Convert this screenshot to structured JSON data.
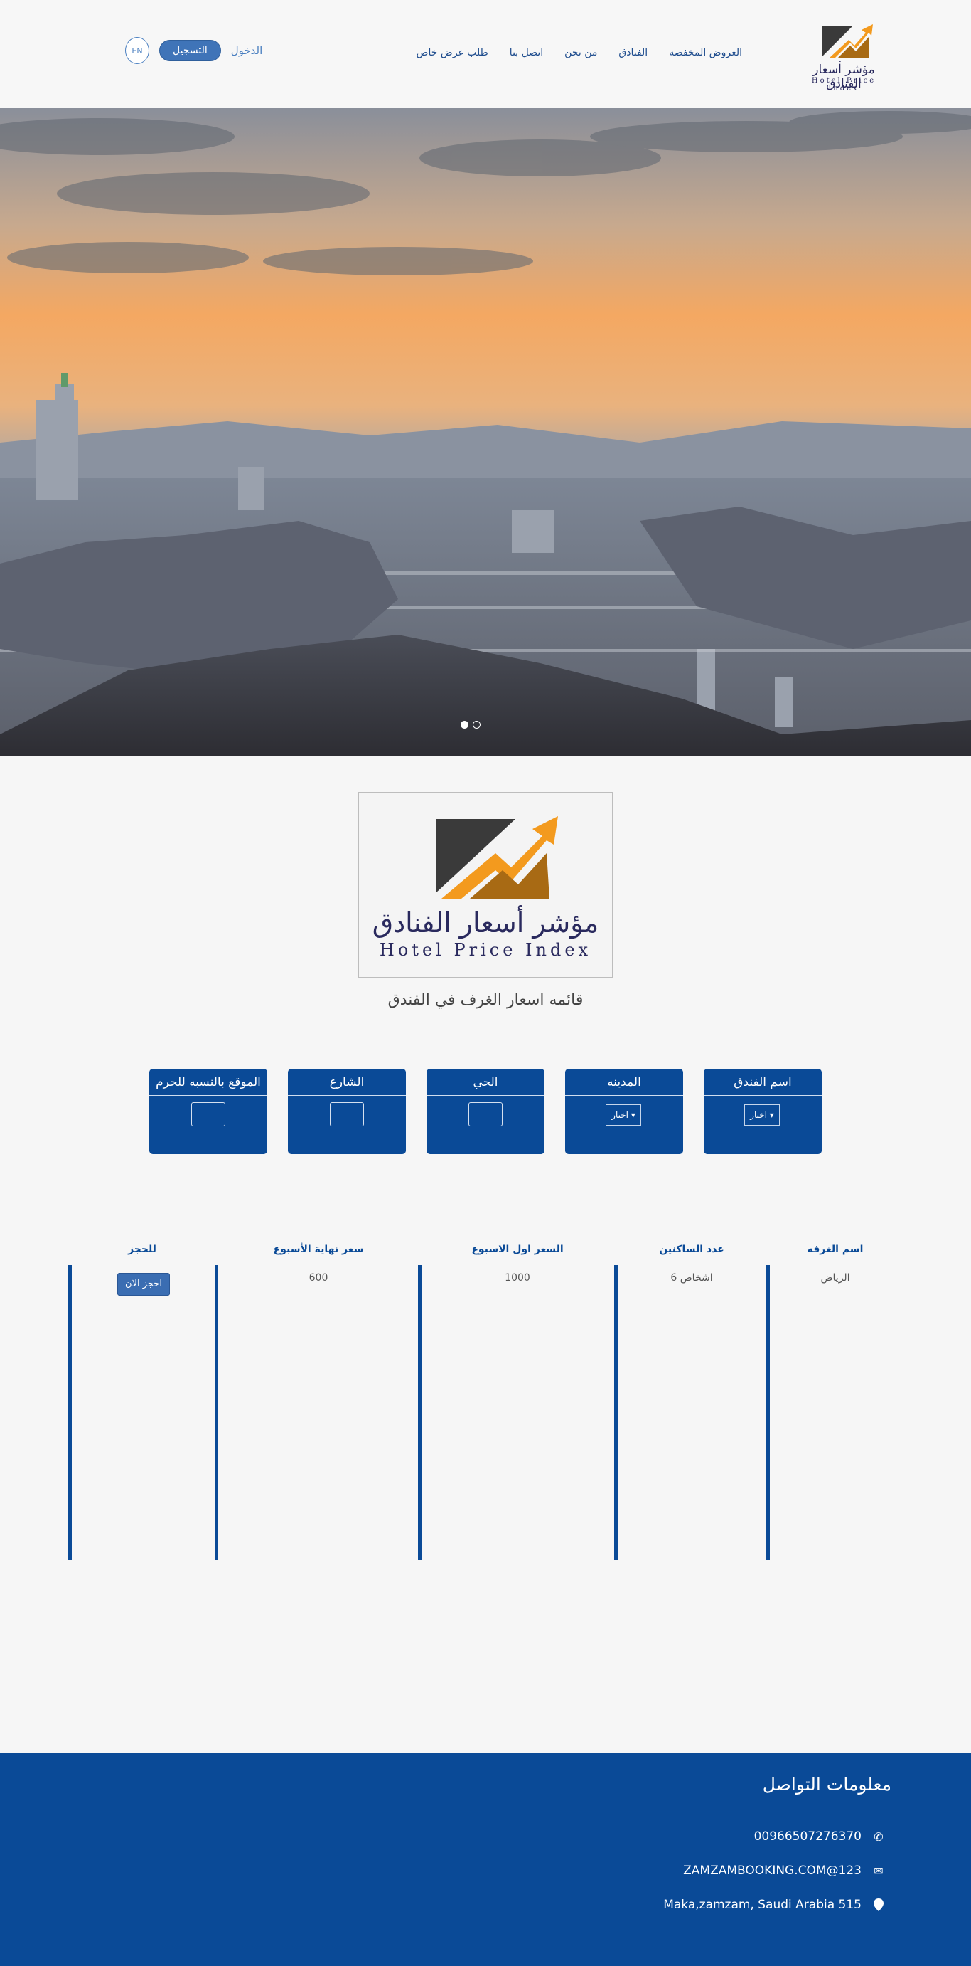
{
  "header": {
    "logo_ar": "مؤشر أسعار الفنادق",
    "logo_en": "Hotel Price Index",
    "nav": [
      "العروض المخفضه",
      "الفنادق",
      "من نحن",
      "اتصل بنا",
      "طلب عرض خاص"
    ],
    "login": "الدخول",
    "register": "التسجيل",
    "lang": "EN"
  },
  "hero": {
    "slides": 2,
    "active_slide": 1
  },
  "brand": {
    "ar": "مؤشر أسعار الفنادق",
    "en": "Hotel Price Index"
  },
  "list_title": "قائمه اسعار الغرف في الفندق",
  "filters": [
    {
      "label": "اسم الفندق",
      "type": "select",
      "value": "اختار"
    },
    {
      "label": "المدينه",
      "type": "select",
      "value": "اختار"
    },
    {
      "label": "الحي",
      "type": "input",
      "value": ""
    },
    {
      "label": "الشارع",
      "type": "input",
      "value": ""
    },
    {
      "label": "الموقع بالنسبه للحرم",
      "type": "input",
      "value": ""
    }
  ],
  "table": {
    "headers": [
      "اسم الغرفه",
      "عدد الساكنين",
      "السعر اول الاسبوع",
      "سعر نهاية الأسبوع",
      "للحجز"
    ],
    "rows": [
      [
        "الرياض",
        "6 اشخاص",
        "1000",
        "600",
        "احجز الان"
      ]
    ]
  },
  "footer": {
    "title": "معلومات التواصل",
    "phone": "00966507276370",
    "email": "ZAMZAMBOOKING.COM@123",
    "address": "Maka,zamzam, Saudi Arabia 515"
  },
  "colors": {
    "brand_blue": "#0a4a97",
    "accent_orange": "#f39a1e",
    "dark": "#3a3a3a"
  }
}
